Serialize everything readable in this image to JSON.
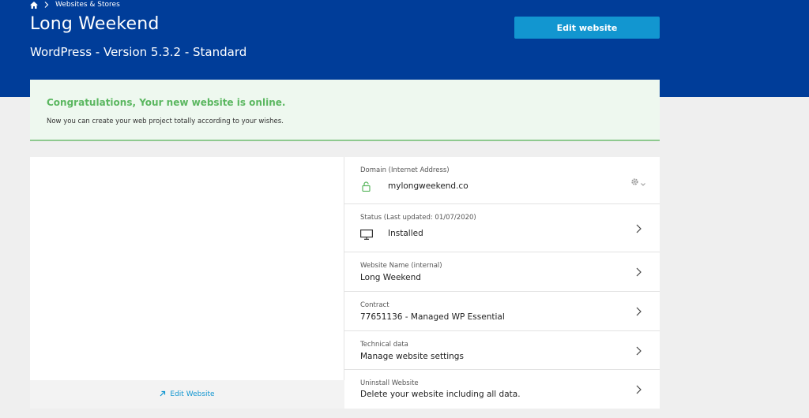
{
  "breadcrumb": {
    "home_icon": "home-icon",
    "separator_icon": "chevron-right-icon",
    "item": "Websites & Stores"
  },
  "header": {
    "title": "Long Weekend",
    "subtitle": "WordPress  - Version 5.3.2 - Standard",
    "edit_button": "Edit website",
    "background": "#003d99",
    "button_color": "#1296d0"
  },
  "notice": {
    "title": "Congratulations, Your new website is online.",
    "text": "Now you can create your web project totally according to your wishes.",
    "accent": "#5bb760"
  },
  "preview": {
    "edit_link": "Edit Website",
    "link_icon": "arrow-up-right-icon"
  },
  "details": {
    "domain": {
      "label": "Domain (Internet Address)",
      "value": "mylongweekend.co",
      "icon": "lock-icon",
      "settings_icon": "gear-icon"
    },
    "status": {
      "label": "Status  (Last updated: 01/07/2020)",
      "value": "Installed",
      "icon": "monitor-icon"
    },
    "website_name": {
      "label": "Website Name (internal)",
      "value": "Long Weekend"
    },
    "contract": {
      "label": "Contract",
      "value": "77651136 - Managed WP Essential"
    },
    "technical": {
      "label": "Technical data",
      "value": "Manage website settings"
    },
    "uninstall": {
      "label": "Uninstall Website",
      "value": "Delete your website including all data."
    }
  }
}
